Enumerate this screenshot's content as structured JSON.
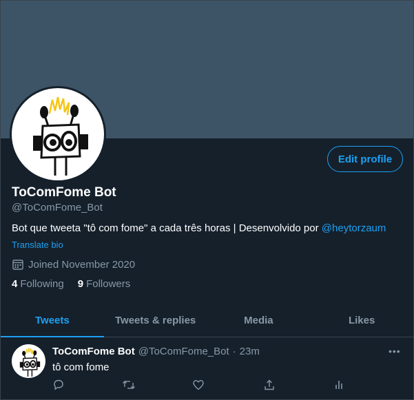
{
  "profile": {
    "name": "ToComFome Bot",
    "handle": "@ToComFome_Bot",
    "bio_text": "Bot que tweeta \"tô com fome\" a cada três horas | Desenvolvido por",
    "bio_link": "@heytorzaum",
    "translate_label": "Translate bio",
    "joined": "Joined November 2020",
    "following_count": "4",
    "following_label": "Following",
    "followers_count": "9",
    "followers_label": "Followers",
    "edit_label": "Edit profile"
  },
  "tabs": [
    {
      "label": "Tweets",
      "active": true
    },
    {
      "label": "Tweets & replies",
      "active": false
    },
    {
      "label": "Media",
      "active": false
    },
    {
      "label": "Likes",
      "active": false
    }
  ],
  "tweet": {
    "author": "ToComFome Bot",
    "handle": "@ToComFome_Bot",
    "separator": "·",
    "time": "23m",
    "text": "tô com fome",
    "more_label": "•••",
    "action_icons": [
      "reply-icon",
      "retweet-icon",
      "like-icon",
      "share-icon",
      "analytics-icon"
    ]
  },
  "colors": {
    "background": "#15202b",
    "banner": "#3d5466",
    "accent": "#1da1f2",
    "secondary_text": "#8899a6",
    "border": "#38444d"
  }
}
